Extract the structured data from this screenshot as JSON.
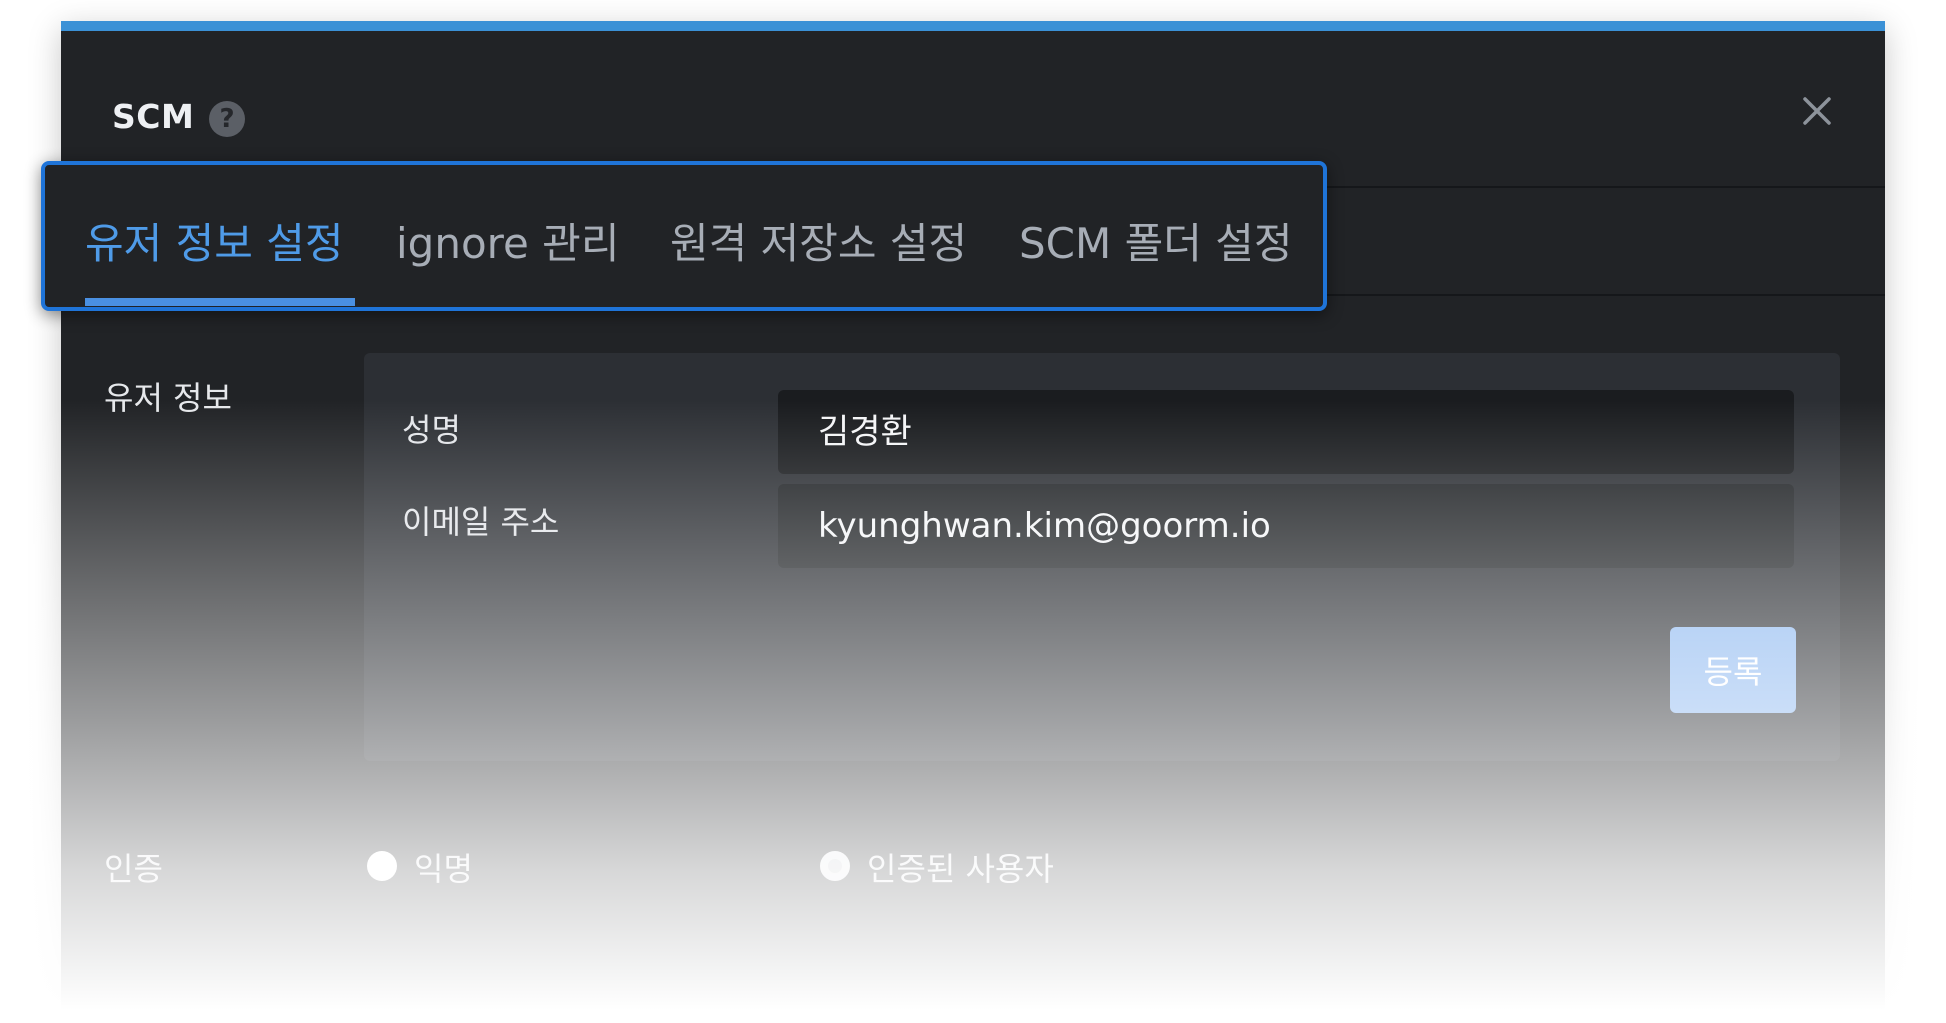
{
  "dialog": {
    "title": "SCM",
    "help_icon": "?",
    "accent_color": "#3b91d6"
  },
  "tabs": [
    {
      "label": "유저 정보 설정",
      "active": true
    },
    {
      "label": "ignore 관리",
      "active": false
    },
    {
      "label": "원격 저장소 설정",
      "active": false
    },
    {
      "label": "SCM 폴더 설정",
      "active": false
    }
  ],
  "user_info": {
    "section_label": "유저 정보",
    "name_label": "성명",
    "name_value": "김경환",
    "email_label": "이메일 주소",
    "email_value": "kyunghwan.kim@goorm.io",
    "register_label": "등록"
  },
  "auth": {
    "section_label": "인증",
    "options": [
      {
        "label": "익명",
        "selected": false
      },
      {
        "label": "인증된 사용자",
        "selected": true
      }
    ]
  },
  "icons": {
    "help": "question-circle-icon",
    "close": "close-icon"
  }
}
